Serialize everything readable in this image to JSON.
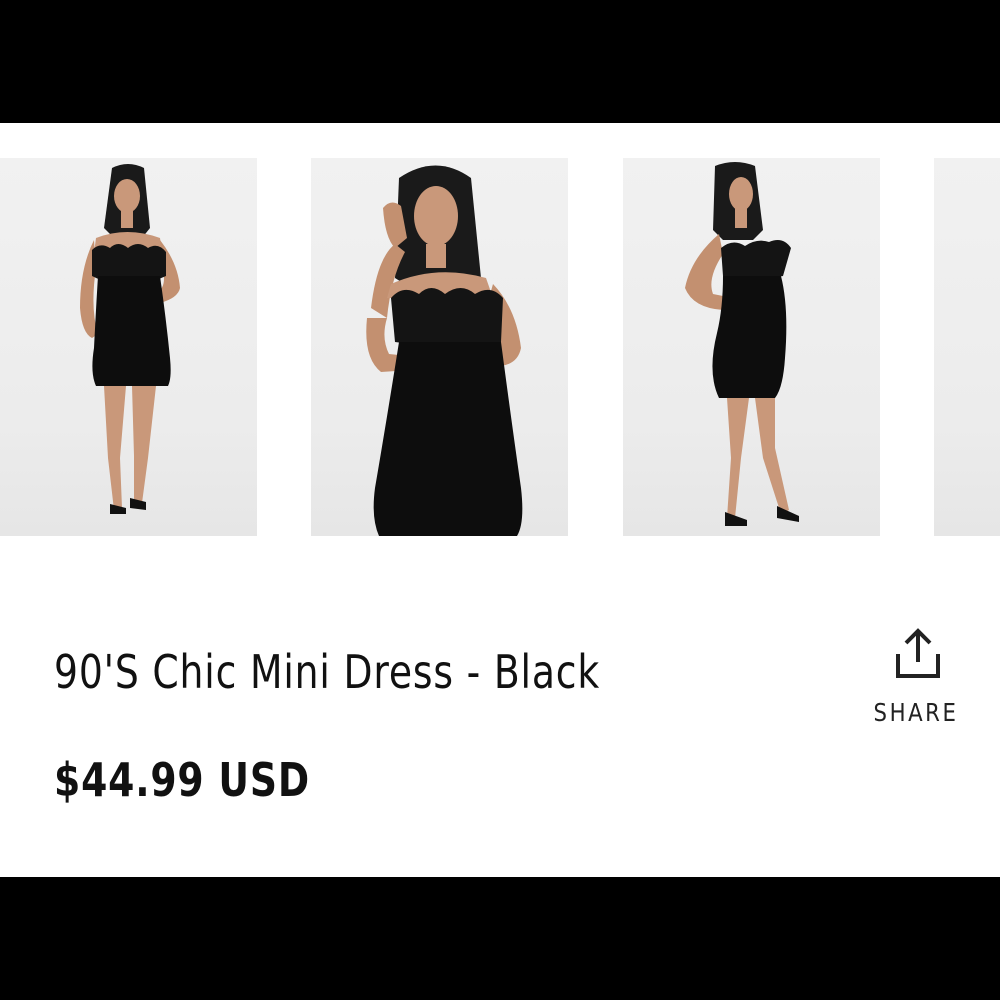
{
  "product": {
    "title": "90'S Chic Mini Dress - Black",
    "price": "$44.99 USD"
  },
  "share": {
    "label": "SHARE",
    "icon": "share-icon"
  },
  "gallery": {
    "images": [
      {
        "name": "front view"
      },
      {
        "name": "close-up view"
      },
      {
        "name": "side view"
      },
      {
        "name": "next image (partially visible)"
      }
    ]
  },
  "colors": {
    "letterbox": "#000000",
    "background": "#ffffff",
    "text": "#111111",
    "dress": "#0d0d0d"
  }
}
